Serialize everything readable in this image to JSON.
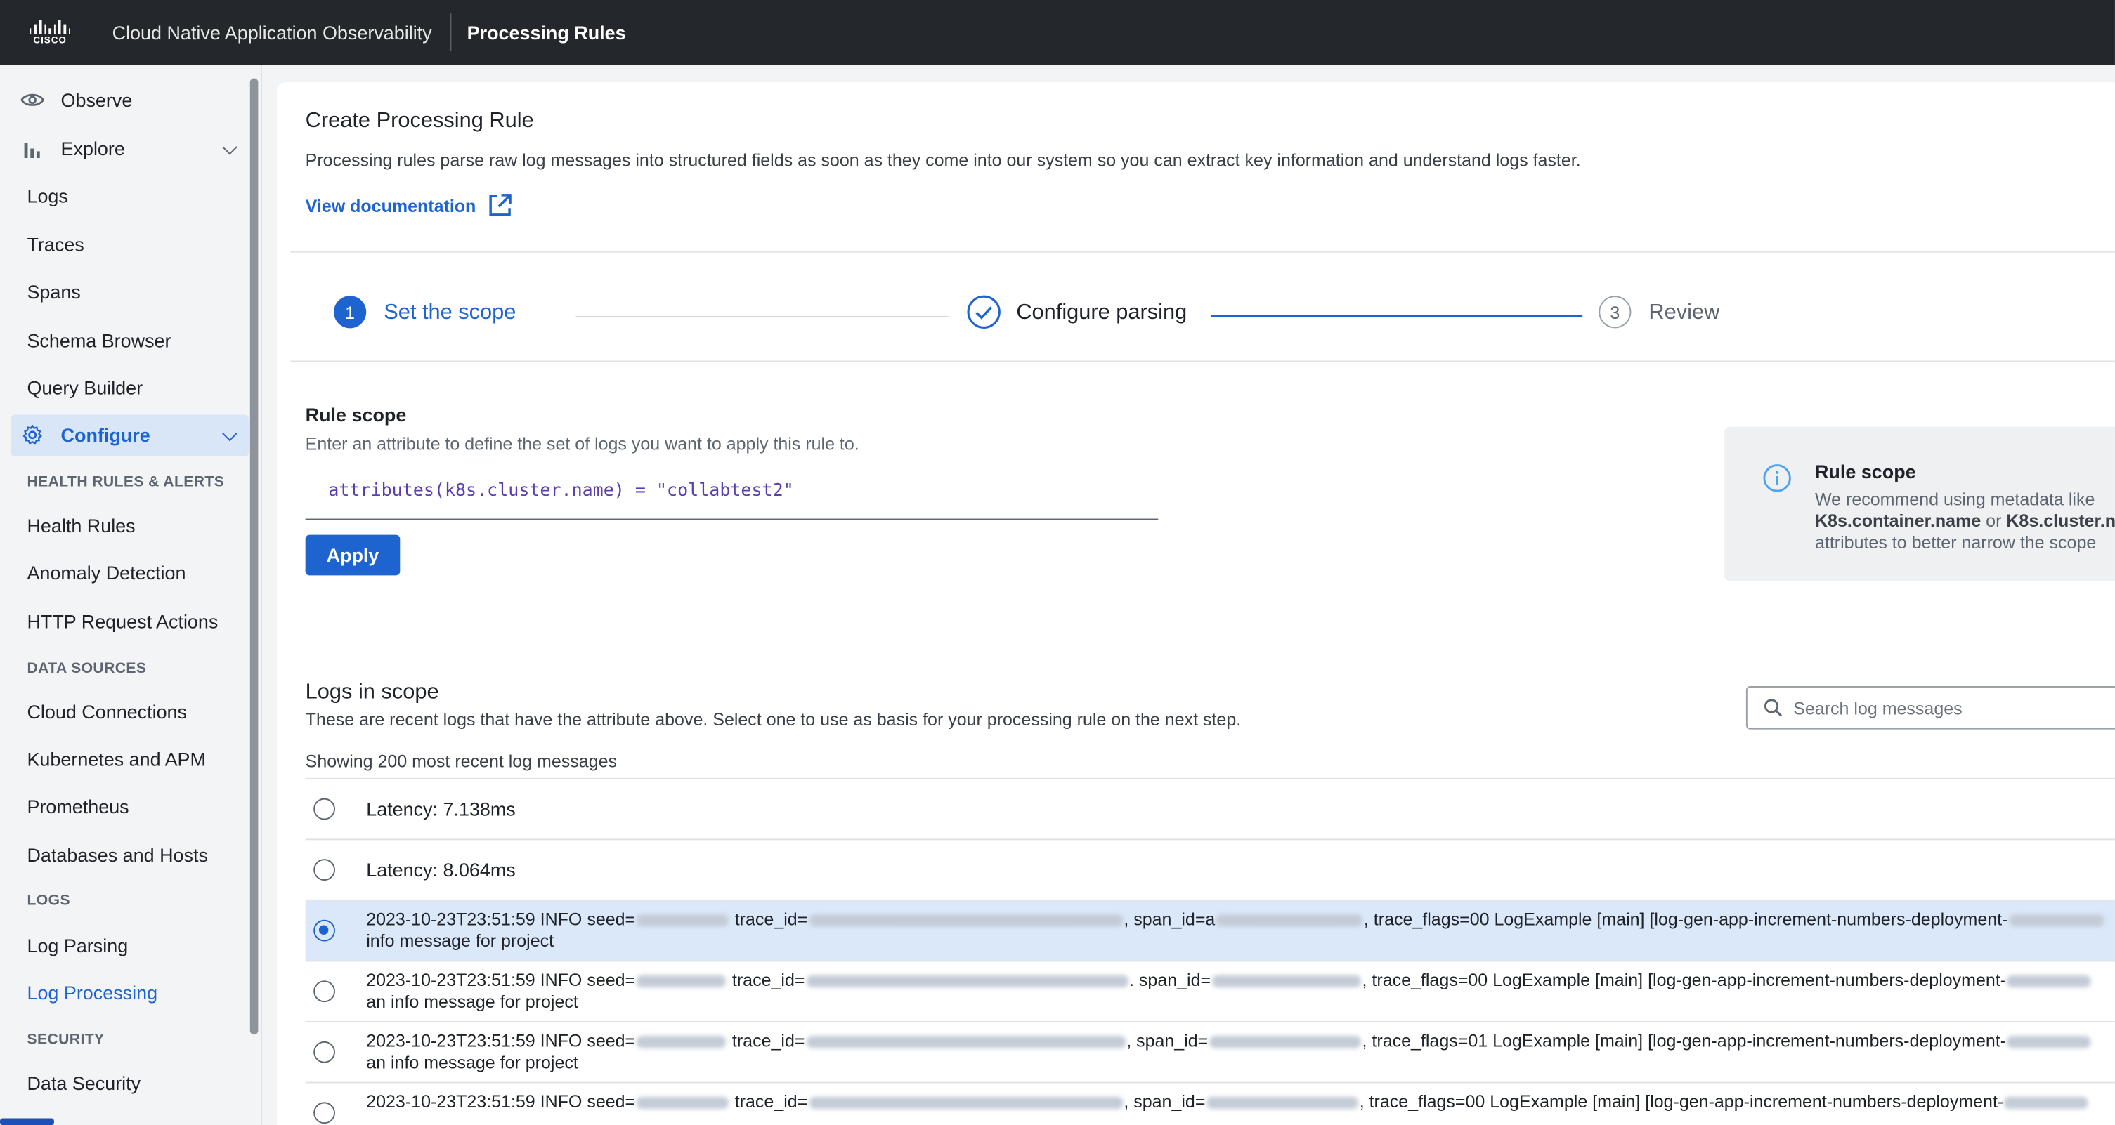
{
  "topbar": {
    "logo_text": "CISCO",
    "app_title": "Cloud Native Application Observability",
    "page_name": "Processing Rules"
  },
  "sidebar": {
    "observe": "Observe",
    "explore": "Explore",
    "explore_items": [
      "Logs",
      "Traces",
      "Spans",
      "Schema Browser",
      "Query Builder"
    ],
    "configure": "Configure",
    "sections": {
      "health": "HEALTH RULES & ALERTS",
      "data_sources": "DATA SOURCES",
      "logs": "LOGS",
      "security": "SECURITY"
    },
    "health_items": [
      "Health Rules",
      "Anomaly Detection",
      "HTTP Request Actions"
    ],
    "data_source_items": [
      "Cloud Connections",
      "Kubernetes and APM",
      "Prometheus",
      "Databases and Hosts"
    ],
    "logs_items": [
      "Log Parsing",
      "Log Processing"
    ],
    "security_items": [
      "Data Security"
    ]
  },
  "main": {
    "title": "Create Processing Rule",
    "description": "Processing rules parse raw log messages into structured fields as soon as they come into our system so you can extract key information and understand logs faster.",
    "doc_link": "View documentation",
    "steps": [
      {
        "number": "1",
        "label": "Set the scope",
        "state": "active"
      },
      {
        "number": "",
        "label": "Configure parsing",
        "state": "complete"
      },
      {
        "number": "3",
        "label": "Review",
        "state": "pending"
      }
    ],
    "rule_scope": {
      "label": "Rule scope",
      "help": "Enter an attribute to define the set of logs you want to apply this rule to.",
      "expression": "attributes(k8s.cluster.name) = \"collabtest2\"",
      "apply_label": "Apply"
    },
    "info": {
      "title": "Rule scope",
      "line1": "We recommend using metadata like",
      "line2_bold1": "K8s.container.name",
      "line2_mid": " or ",
      "line2_bold2": "K8s.cluster.n",
      "line3": "attributes to better narrow the scope"
    },
    "logs": {
      "title": "Logs in scope",
      "description": "These are recent logs that have the attribute above. Select one to use as basis for your processing rule on the next step.",
      "count_text": "Showing 200 most recent log messages",
      "search_placeholder": "Search log messages",
      "rows": [
        {
          "text": "Latency: 7.138ms",
          "selected": false
        },
        {
          "text": "Latency: 8.064ms",
          "selected": false
        },
        {
          "ts": "2023-10-23T23:51:59 INFO seed=",
          "trace": " trace_id=",
          "span": ", span_id=a",
          "flags": ", trace_flags=00 LogExample [main] [log-gen-app-increment-numbers-deployment-",
          "line2": "info message for project",
          "selected": true
        },
        {
          "ts": "2023-10-23T23:51:59 INFO seed=",
          "trace": " trace_id=",
          "span": ". span_id=",
          "flags": ", trace_flags=00 LogExample [main] [log-gen-app-increment-numbers-deployment-",
          "line2": "an info message for project",
          "selected": false
        },
        {
          "ts": "2023-10-23T23:51:59 INFO seed=",
          "trace": " trace_id=",
          "span": ", span_id=",
          "flags": ", trace_flags=01 LogExample [main] [log-gen-app-increment-numbers-deployment-",
          "line2": "an info message for project",
          "selected": false
        },
        {
          "ts": "2023-10-23T23:51:59 INFO seed=",
          "trace": " trace_id=",
          "span": ", span_id=",
          "flags": ", trace_flags=00 LogExample [main] [log-gen-app-increment-numbers-deployment-",
          "line2": "",
          "selected": false
        }
      ]
    }
  },
  "colors": {
    "accent": "#1d64d0",
    "topbar": "#24282c",
    "selected_row": "#dbe8f9",
    "sidebar_active": "#d9e6f7"
  }
}
